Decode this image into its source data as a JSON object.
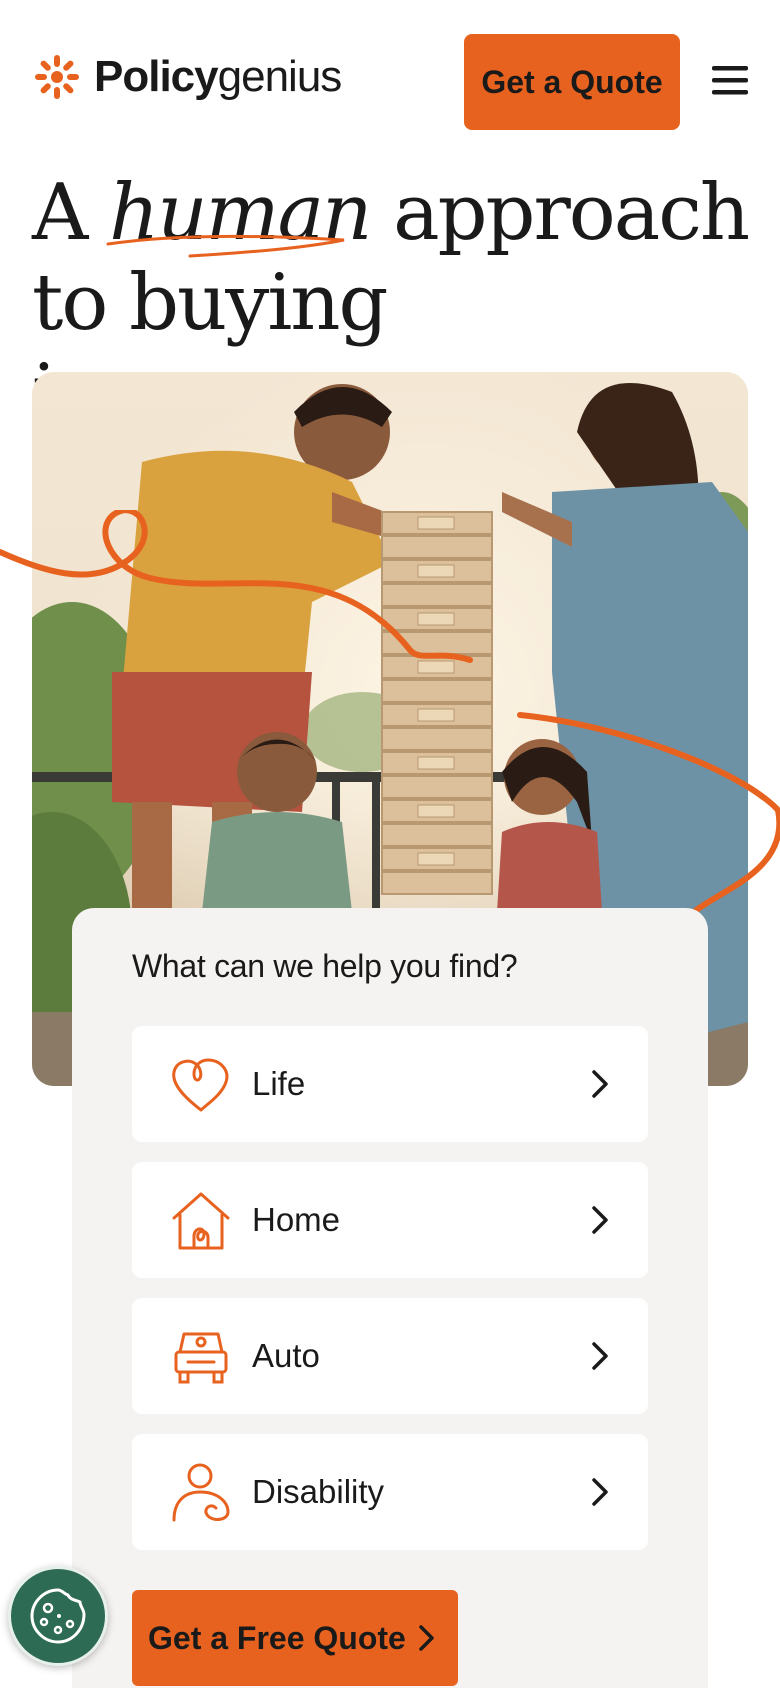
{
  "header": {
    "logo_bold": "Policy",
    "logo_light": "genius",
    "quote_button": "Get a Quote"
  },
  "headline": {
    "word_a": "A",
    "word_emphasis": "human",
    "rest_line1": "approach",
    "line2": "to buying insurance."
  },
  "finder": {
    "title": "What can we help you find?",
    "options": [
      {
        "label": "Life",
        "icon": "heart-icon"
      },
      {
        "label": "Home",
        "icon": "house-icon"
      },
      {
        "label": "Auto",
        "icon": "car-icon"
      },
      {
        "label": "Disability",
        "icon": "person-icon"
      }
    ],
    "cta": "Get a Free Quote"
  },
  "colors": {
    "accent": "#e8621f",
    "card_bg": "#f5f3f1",
    "cookie_bg": "#2e6b55"
  }
}
